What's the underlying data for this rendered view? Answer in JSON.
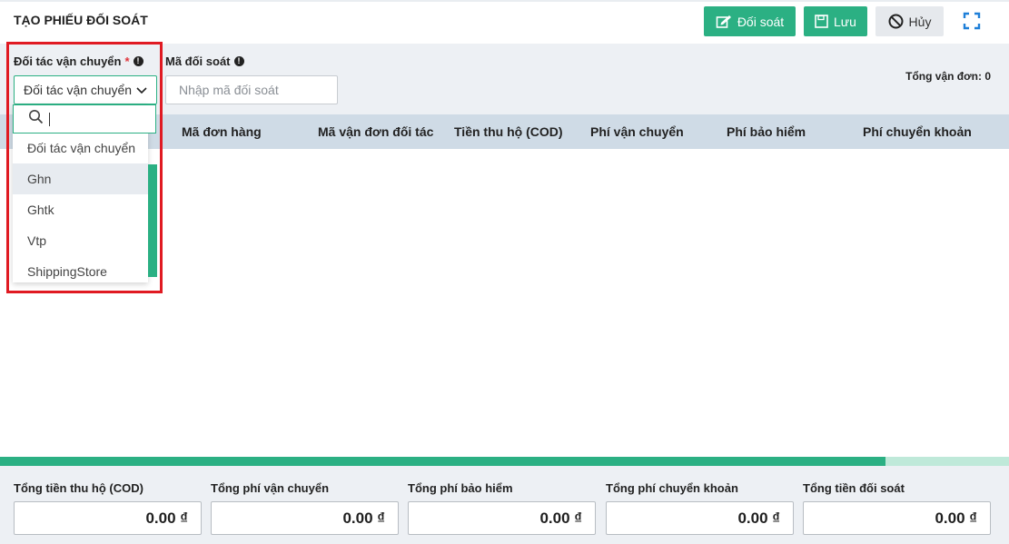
{
  "header": {
    "title": "TẠO PHIẾU ĐỐI SOÁT",
    "reconcile_label": "Đối soát",
    "save_label": "Lưu",
    "cancel_label": "Hủy"
  },
  "filters": {
    "partner_label": "Đối tác vận chuyển",
    "partner_required": "*",
    "partner_value": "Đối tác vận chuyển",
    "code_label": "Mã đối soát",
    "code_placeholder": "Nhập mã đối soát",
    "total_orders": "Tổng vận đơn: 0"
  },
  "dropdown": {
    "search_value": "",
    "options": [
      "Đối tác vận chuyển",
      "Ghn",
      "Ghtk",
      "Vtp",
      "ShippingStore"
    ],
    "highlighted": "Ghn"
  },
  "table": {
    "columns": [
      "Mã đơn hàng",
      "Mã vận đơn đối tác",
      "Tiền thu hộ (COD)",
      "Phí vận chuyển",
      "Phí bảo hiểm",
      "Phí chuyển khoản"
    ]
  },
  "progress": {
    "fraction": 0.878
  },
  "totals": [
    {
      "label": "Tổng tiền thu hộ (COD)",
      "value": "0.00 ₫"
    },
    {
      "label": "Tổng phí vận chuyển",
      "value": "0.00 ₫"
    },
    {
      "label": "Tổng phí bảo hiểm",
      "value": "0.00 ₫"
    },
    {
      "label": "Tổng phí chuyển khoản",
      "value": "0.00 ₫"
    },
    {
      "label": "Tổng tiền đối soát",
      "value": "0.00 ₫"
    }
  ],
  "colors": {
    "accent": "#2bb083",
    "highlight_border": "#e01a22"
  }
}
